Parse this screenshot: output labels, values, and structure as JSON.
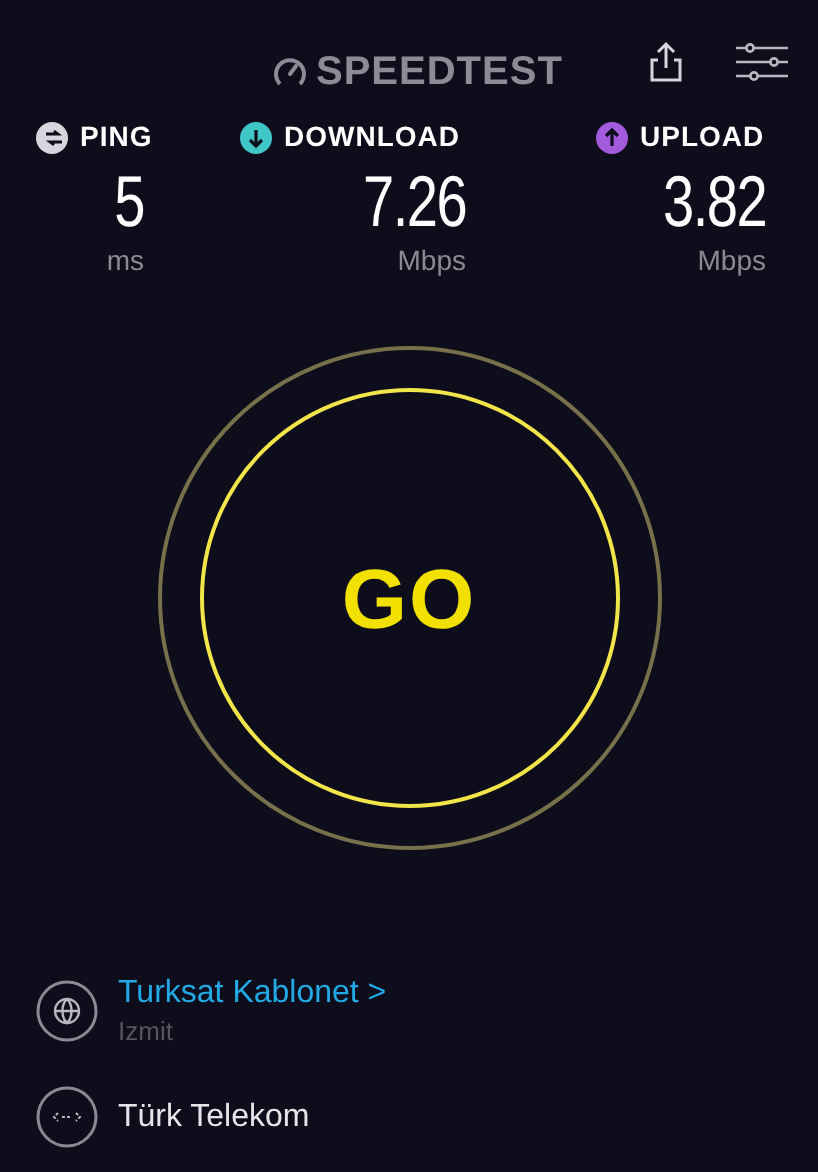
{
  "header": {
    "logo": "SPEEDTEST"
  },
  "metrics": [
    {
      "kind": "ping",
      "label": "PING",
      "value": "5",
      "unit": "ms",
      "color": "#d6d6dc"
    },
    {
      "kind": "download",
      "label": "DOWNLOAD",
      "value": "7.26",
      "unit": "Mbps",
      "color": "#3fc6c6"
    },
    {
      "kind": "upload",
      "label": "UPLOAD",
      "value": "3.82",
      "unit": "Mbps",
      "color": "#a25bdc"
    }
  ],
  "go_button": {
    "label": "GO"
  },
  "server": {
    "name": "Turksat Kablonet",
    "chevron": ">",
    "location": "Izmit"
  },
  "provider": {
    "name": "Türk Telekom"
  }
}
